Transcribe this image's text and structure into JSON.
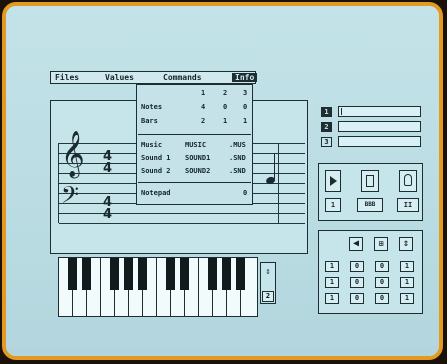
{
  "menubar": {
    "files": "Files",
    "values": "Values",
    "commands": "Commands",
    "info": "Info"
  },
  "info_menu": {
    "columns": [
      "1",
      "2",
      "3"
    ],
    "rows": [
      {
        "label": "Notes",
        "values": [
          "4",
          "0",
          "0"
        ]
      },
      {
        "label": "Bars",
        "values": [
          "2",
          "1",
          "1"
        ]
      }
    ],
    "files": [
      {
        "label": "Music",
        "name": "MUSIC",
        "ext": ".MUS"
      },
      {
        "label": "Sound 1",
        "name": "SOUND1",
        "ext": ".SND"
      },
      {
        "label": "Sound 2",
        "name": "SOUND2",
        "ext": ".SND"
      }
    ],
    "notepad_label": "Notepad",
    "notepad_value": "0"
  },
  "staff": {
    "treble_time_top": "4",
    "treble_time_bottom": "4",
    "bass_time_top": "4",
    "bass_time_bottom": "4"
  },
  "tracks": [
    "1",
    "2",
    "3"
  ],
  "controls": {
    "play_number": "1",
    "stop_number": "BBB",
    "rec_number": "II"
  },
  "keyboard": {
    "octave_value": "2"
  },
  "keypad": {
    "rows": [
      [
        "1",
        "0",
        "0",
        "1"
      ],
      [
        "1",
        "0",
        "0",
        "1"
      ],
      [
        "1",
        "0",
        "0",
        "1"
      ]
    ]
  }
}
